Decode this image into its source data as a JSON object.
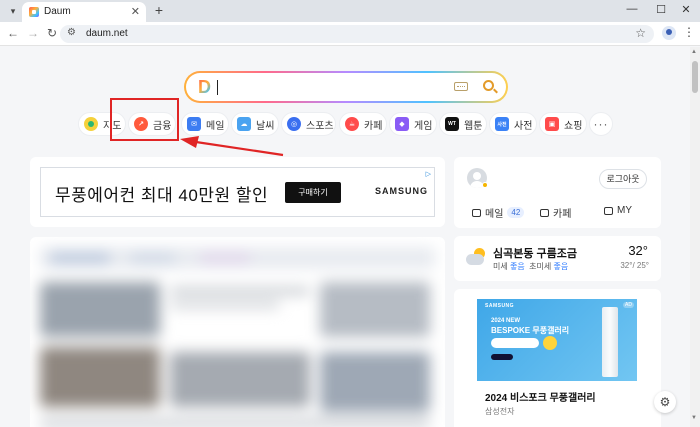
{
  "browser": {
    "tab_title": "Daum",
    "url": "daum.net",
    "icons": {
      "tab_menu": "chevron-down-icon",
      "close": "close-icon",
      "new_tab": "plus-icon",
      "minimize": "minimize-icon",
      "maximize": "maximize-icon",
      "window_close": "close-icon",
      "back": "arrow-left-icon",
      "forward": "arrow-right-icon",
      "reload": "reload-icon",
      "site_info": "tune-icon",
      "bookmark": "star-icon",
      "profile": "person-icon",
      "menu": "kebab-icon"
    }
  },
  "search": {
    "logo": "D",
    "value": ""
  },
  "services": [
    {
      "label": "지도",
      "icon": "map-pin-icon",
      "color": "#2bb673"
    },
    {
      "label": "금융",
      "icon": "finance-chart-icon",
      "color": "#ff5a3c"
    },
    {
      "label": "메일",
      "icon": "mail-icon",
      "color": "#3d7df2"
    },
    {
      "label": "날씨",
      "icon": "cloud-icon",
      "color": "#4aa3f0"
    },
    {
      "label": "스포츠",
      "icon": "sports-icon",
      "color": "#3b6ff0"
    },
    {
      "label": "카페",
      "icon": "cafe-icon",
      "color": "#ff4b4b"
    },
    {
      "label": "게임",
      "icon": "game-icon",
      "color": "#8a5cf5"
    },
    {
      "label": "웹툰",
      "icon": "webtoon-icon",
      "color": "#111111",
      "glyph": "WT"
    },
    {
      "label": "사전",
      "icon": "dictionary-icon",
      "color": "#3b82f6",
      "glyph": "사전"
    },
    {
      "label": "쇼핑",
      "icon": "shopping-bag-icon",
      "color": "#ff4b4b"
    }
  ],
  "more_label": "···",
  "ad": {
    "text": "무풍에어컨 최대 40만원 할인",
    "button": "구매하기",
    "brand": "SAMSUNG",
    "badge": "▷"
  },
  "login": {
    "logout": "로그아웃",
    "mail_label": "메일",
    "mail_count": "42",
    "cafe_label": "카페",
    "my_label": "MY"
  },
  "weather": {
    "title": "심곡본동 구름조금",
    "dust_label": "미세",
    "dust_value": "좋음",
    "fine_dust_label": "초미세",
    "fine_dust_value": "좋음",
    "temp": "32°",
    "range": "32°/ 25°"
  },
  "promo": {
    "brand": "SAMSUNG",
    "ad_badge": "AD",
    "year": "2024 NEW",
    "name": "BESPOKE 무풍갤러리",
    "title": "2024 비스포크 무풍갤러리",
    "sub": "삼성전자"
  },
  "colors": {
    "annotation": "#e02525",
    "accent_blue": "#2e7bff"
  }
}
